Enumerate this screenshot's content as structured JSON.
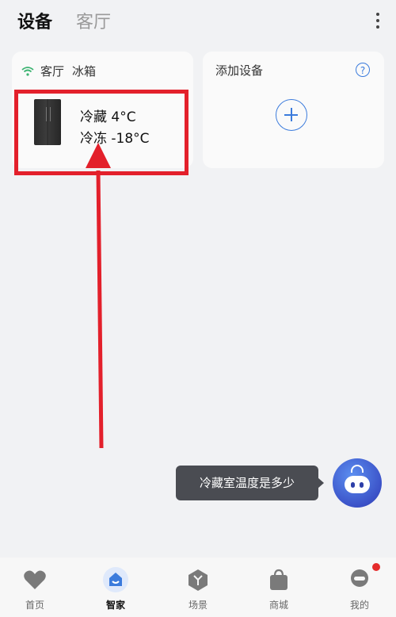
{
  "header": {
    "tabs": [
      {
        "label": "设备",
        "active": true
      },
      {
        "label": "客厅",
        "active": false
      }
    ]
  },
  "devices": {
    "fridge": {
      "room": "客厅",
      "name": "冰箱",
      "fridge_temp": "冷藏 4°C",
      "freezer_temp": "冷冻 -18°C"
    },
    "add_device": {
      "title": "添加设备"
    }
  },
  "assistant": {
    "bubble_text": "冷藏室温度是多少"
  },
  "tabbar": {
    "items": [
      {
        "label": "首页",
        "icon": "heart-icon"
      },
      {
        "label": "智家",
        "icon": "smart-home-icon",
        "active": true
      },
      {
        "label": "场景",
        "icon": "scene-icon"
      },
      {
        "label": "商城",
        "icon": "shopping-bag-icon"
      },
      {
        "label": "我的",
        "icon": "profile-icon"
      }
    ]
  },
  "colors": {
    "accent": "#3b7bdc",
    "highlight": "#e3202b",
    "wifi": "#3cb371"
  }
}
